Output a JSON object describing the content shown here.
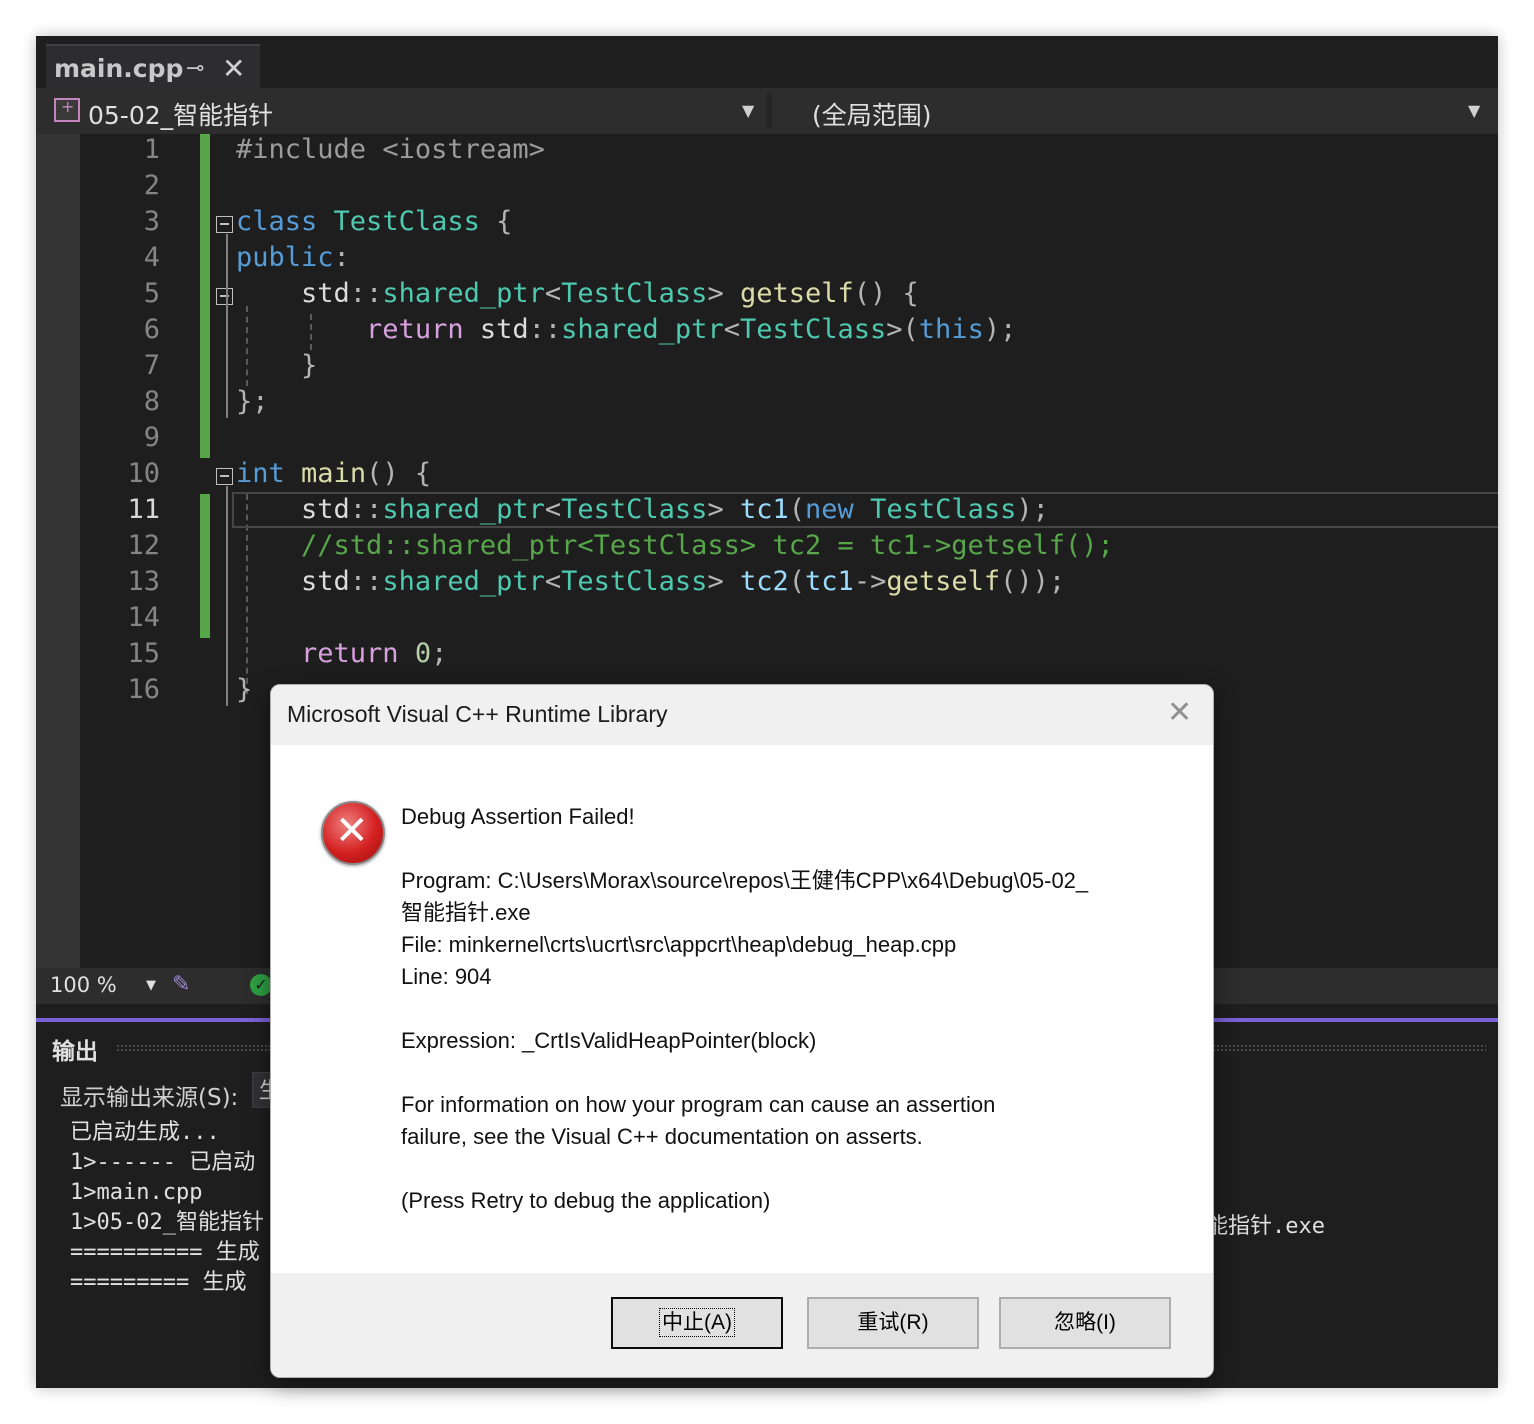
{
  "tab": {
    "title": "main.cpp",
    "pin_icon": "pin-icon",
    "close_icon": "close-icon"
  },
  "navbar": {
    "project": "05-02_智能指针",
    "scope": "(全局范围)"
  },
  "editor": {
    "line_numbers": [
      "1",
      "2",
      "3",
      "4",
      "5",
      "6",
      "7",
      "8",
      "9",
      "10",
      "11",
      "12",
      "13",
      "14",
      "15",
      "16"
    ],
    "current_line": "11"
  },
  "status": {
    "zoom": "100 %"
  },
  "output": {
    "title": "输出",
    "source_label": "显示输出来源(S):",
    "source_value": "生",
    "lines": [
      "已启动生成...",
      "1>------ 已启动",
      "1>main.cpp",
      "1>05-02_智能指针",
      "========== 生成",
      "========= 生成"
    ],
    "line4_tail": "能指针.exe"
  },
  "dialog": {
    "title": "Microsoft Visual C++ Runtime Library",
    "heading": "Debug Assertion Failed!",
    "program_line1": "Program: C:\\Users\\Morax\\source\\repos\\王健伟CPP\\x64\\Debug\\05-02_",
    "program_line2": "智能指针.exe",
    "file_line": "File: minkernel\\crts\\ucrt\\src\\appcrt\\heap\\debug_heap.cpp",
    "line_line": "Line: 904",
    "expression": "Expression: _CrtIsValidHeapPointer(block)",
    "info_line1": "For information on how your program can cause an assertion",
    "info_line2": "failure, see the Visual C++ documentation on asserts.",
    "retry_hint": "(Press Retry to debug the application)",
    "buttons": {
      "abort": "中止(A)",
      "retry": "重试(R)",
      "ignore": "忽略(I)"
    },
    "icon": "error-icon"
  },
  "colors": {
    "accent": "#7b61d9",
    "change_bar": "#57a64a",
    "error": "#d42020"
  }
}
